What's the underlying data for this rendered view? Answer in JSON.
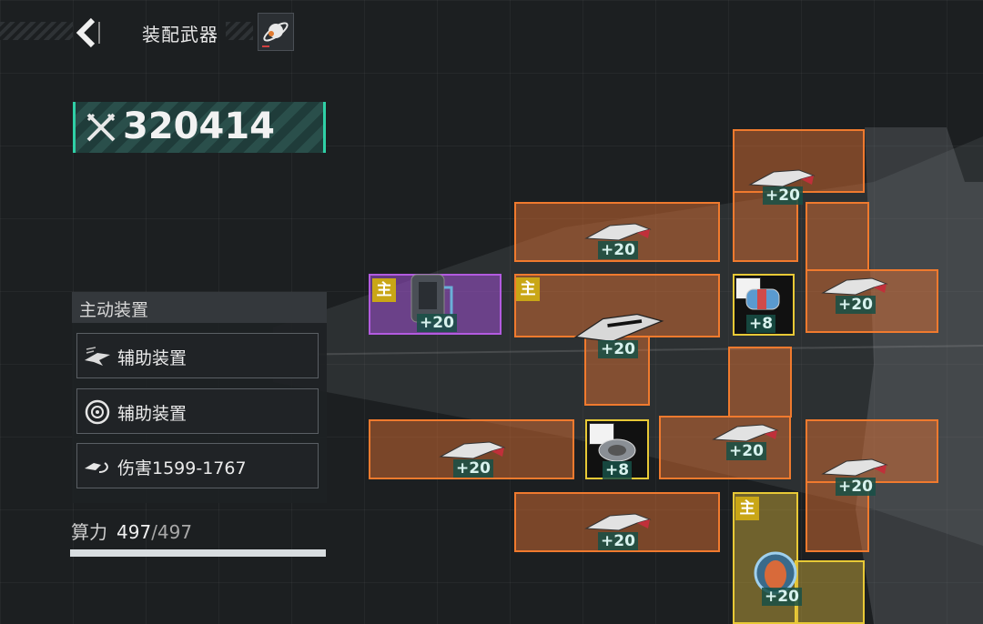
{
  "header": {
    "title": "装配武器"
  },
  "power": {
    "value": "320414"
  },
  "panel": {
    "title": "主动装置",
    "slots": [
      {
        "label": "辅助装置",
        "icon": "fighter-icon"
      },
      {
        "label": "辅助装置",
        "icon": "target-icon"
      },
      {
        "label": "伤害1599-1767",
        "icon": "missile-icon"
      }
    ]
  },
  "compute": {
    "label": "算力",
    "current": "497",
    "max": "/497",
    "fraction": 1.0
  },
  "grid": {
    "main_tag": "主",
    "bonuses": {
      "b1": "+20",
      "b2": "+20",
      "b3": "+20",
      "b4": "+20",
      "b5": "+8",
      "b6": "+20",
      "b7": "+20",
      "b8": "+8",
      "b9": "+20",
      "b10": "+20",
      "b11": "+20",
      "b12": "+20"
    }
  },
  "colors": {
    "accent": "#2fd0a6",
    "orange": "#f07a2e",
    "purple": "#b35be0",
    "gold": "#e8c936"
  }
}
